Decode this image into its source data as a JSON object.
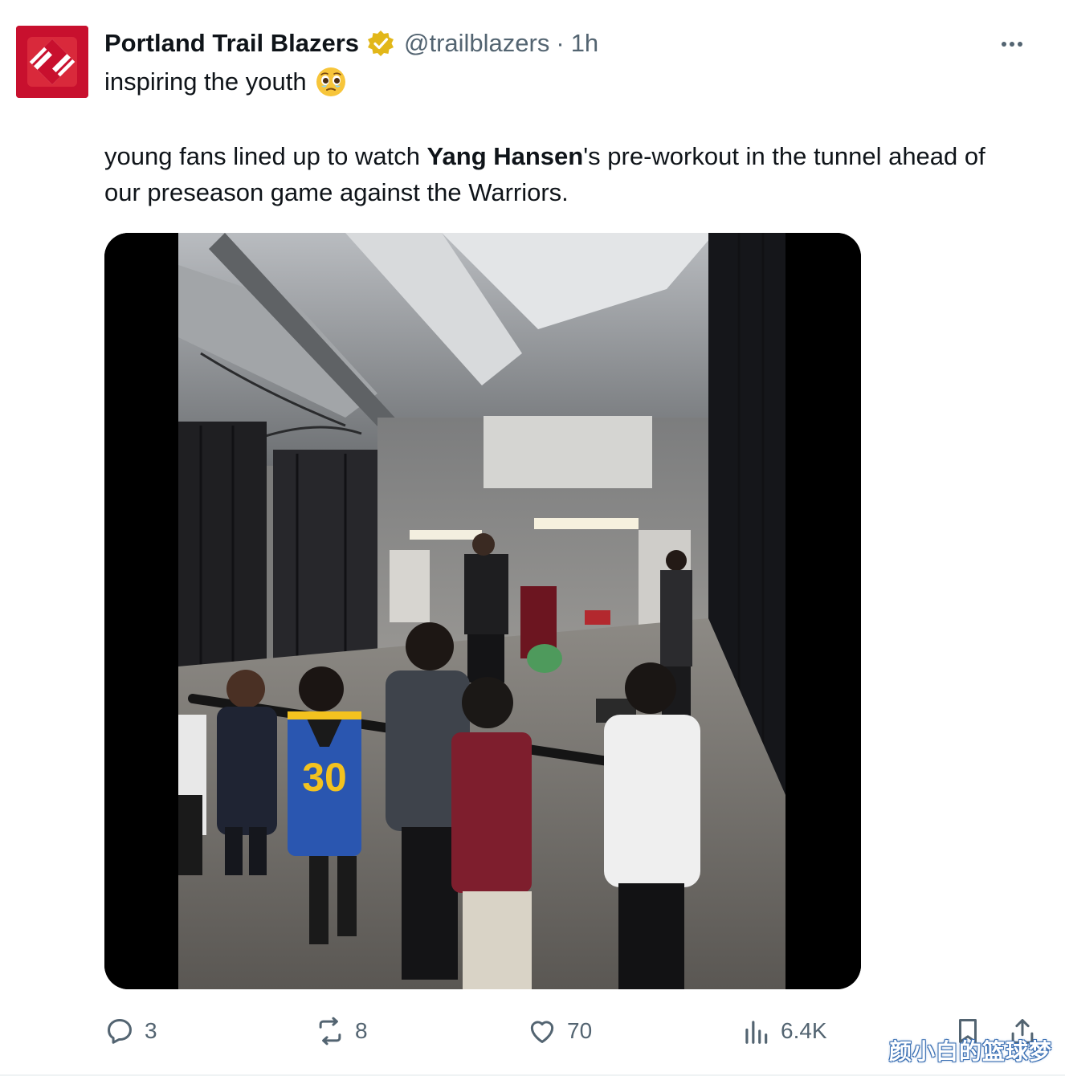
{
  "account": {
    "display_name": "Portland Trail Blazers",
    "handle": "@trailblazers",
    "separator": "·",
    "time": "1h",
    "avatar_color": "#d1202f",
    "verified_color": "#e2b719"
  },
  "tweet": {
    "line1": "inspiring the youth",
    "line1_emoji": "face-holding-back-tears-emoji",
    "body_before": "young fans lined up to watch ",
    "body_bold": "Yang Hansen",
    "body_after": "'s pre-workout in the tunnel ahead of our preseason game against the Warriors.",
    "jersey_number": "30"
  },
  "actions": {
    "replies": "3",
    "reposts": "8",
    "likes": "70",
    "views": "6.4K"
  },
  "watermark": "颜小白的篮球梦"
}
